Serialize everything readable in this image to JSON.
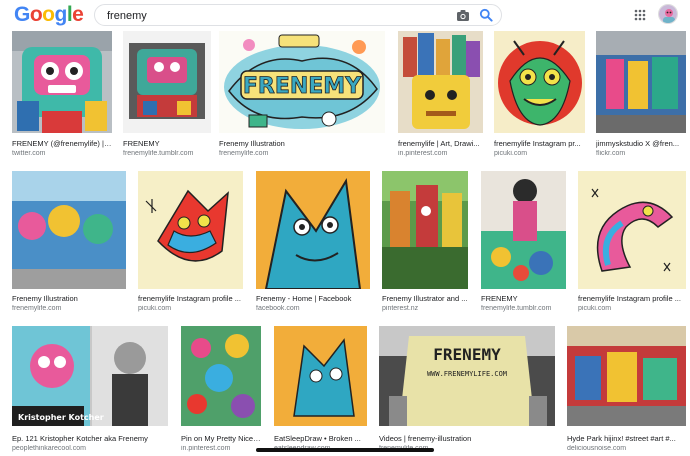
{
  "header": {
    "logo_letters": [
      "G",
      "o",
      "o",
      "g",
      "l",
      "e"
    ],
    "logo_colors": [
      "#4285f4",
      "#ea4335",
      "#fbbc05",
      "#4285f4",
      "#34a853",
      "#ea4335"
    ],
    "search_value": "frenemy"
  },
  "icons": {
    "camera": "camera-icon",
    "search": "search-icon",
    "apps": "apps-grid-icon",
    "avatar": "account-avatar"
  },
  "colors": {
    "accent_blue": "#4285f4",
    "source_gray": "#70757a"
  },
  "results": {
    "row1": [
      {
        "title": "FRENEMY (@frenemylife) | ...",
        "source": "twitter.com"
      },
      {
        "title": "FRENEMY",
        "source": "frenemylife.tumblr.com"
      },
      {
        "title": "Frenemy Illustration",
        "source": "frenemylife.com"
      },
      {
        "title": "frenemylife | Art, Drawi...",
        "source": "in.pinterest.com"
      },
      {
        "title": "frenemylife Instagram pr...",
        "source": "picuki.com"
      },
      {
        "title": "jimmyskstudio X @fren...",
        "source": "flickr.com"
      }
    ],
    "row2": [
      {
        "title": "Frenemy Illustration",
        "source": "frenemylife.com"
      },
      {
        "title": "frenemylife Instagram profile ...",
        "source": "picuki.com"
      },
      {
        "title": "Frenemy - Home | Facebook",
        "source": "facebook.com"
      },
      {
        "title": "Frenemy Illustrator and ...",
        "source": "pinterest.nz"
      },
      {
        "title": "FRENEMY",
        "source": "frenemylife.tumblr.com"
      },
      {
        "title": "frenemylife Instagram profile ...",
        "source": "picuki.com"
      }
    ],
    "row3": [
      {
        "title": "Ep. 121 Kristopher Kotcher aka Frenemy",
        "source": "peoplethinkarecool.com",
        "image_caption": "Kristopher Kotcher"
      },
      {
        "title": "Pin on My Pretty Nice ...",
        "source": "in.pinterest.com"
      },
      {
        "title": "EatSleepDraw • Broken ...",
        "source": "eatsleepdraw.com"
      },
      {
        "title": "Videos | frenemy-illustration",
        "source": "frenemylife.com",
        "image_caption": "FRENEMY",
        "image_subcaption": "WWW.FRENEMYLIFE.COM"
      },
      {
        "title": "Hyde Park hijinx! #street #art #...",
        "source": "deliciousnoise.com"
      }
    ],
    "row1_banner": "FRENEMY"
  }
}
